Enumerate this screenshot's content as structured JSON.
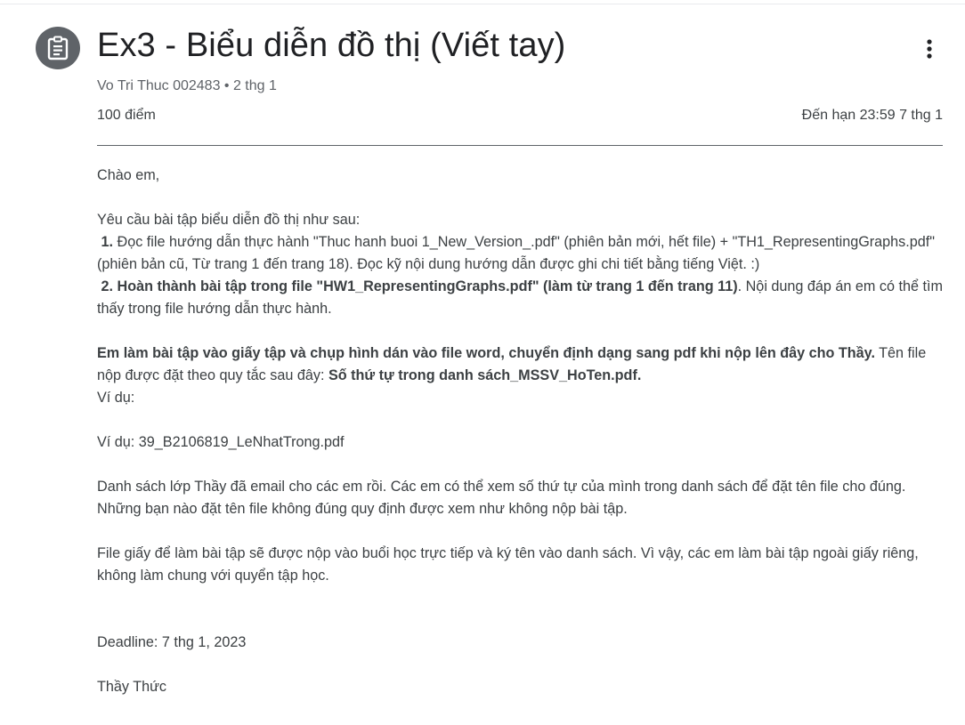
{
  "header": {
    "title": "Ex3 - Biểu diễn đồ thị (Viết tay)",
    "meta": "Vo Tri Thuc 002483 • 2 thg 1",
    "points": "100 điểm",
    "due": "Đến hạn 23:59 7 thg 1"
  },
  "icons": {
    "assignment": "assignment-icon",
    "more": "more-vert-icon"
  },
  "body": {
    "greeting": "Chào em,",
    "intro": "Yêu cầu bài tập biểu diễn đồ thị như sau:",
    "step1_num": "1.",
    "step1_text": " Đọc file hướng dẫn thực hành \"Thuc hanh buoi 1_New_Version_.pdf\" (phiên bản mới, hết file) + \"TH1_RepresentingGraphs.pdf\" (phiên bản cũ, Từ trang 1 đến trang 18). Đọc kỹ nội dung hướng dẫn được ghi chi tiết bằng tiếng Việt. :)",
    "step2_bold": "2. Hoàn thành bài tập trong file \"HW1_RepresentingGraphs.pdf\" (làm từ trang 1 đến trang 11)",
    "step2_rest": ". Nội dung đáp án em có thể tìm thấy trong file hướng dẫn thực hành.",
    "instr_bold": "Em làm bài tập vào giấy tập và chụp hình dán vào file word, chuyển định dạng sang pdf khi nộp lên đây cho Thầy.",
    "instr_rest": " Tên file nộp được đặt theo quy tắc sau đây: ",
    "instr_rule": "Số thứ tự trong danh sách_MSSV_HoTen.pdf.",
    "example_label": "Ví dụ:",
    "example_value": "Ví dụ:  39_B2106819_LeNhatTrong.pdf",
    "list_note": "Danh sách lớp Thầy đã email cho các em rồi. Các em có thể xem số thứ tự của mình trong danh sách để đặt tên file cho đúng. Những bạn nào đặt tên file không đúng quy định được xem như không nộp bài tập.",
    "paper_note": "File giấy để làm bài tập sẽ được nộp vào buổi học trực tiếp và ký tên vào danh sách. Vì vậy, các em làm bài tập ngoài giấy riêng, không làm chung với quyển tập học.",
    "deadline": "Deadline: 7 thg 1, 2023",
    "signature": "Thầy Thức"
  }
}
